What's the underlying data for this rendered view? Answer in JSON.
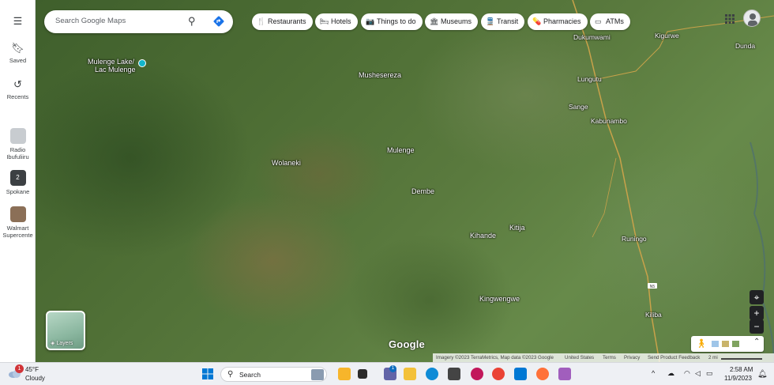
{
  "rail": {
    "menu_icon": "hamburger-menu-icon",
    "items": [
      {
        "label": "Saved",
        "icon": "bookmark-icon"
      },
      {
        "label": "Recents",
        "icon": "history-icon"
      }
    ],
    "recent_places": [
      {
        "label": "Radio Ibufuliiru",
        "color": "#9aa0a6"
      },
      {
        "label": "Spokane",
        "badge": "2",
        "color": "#3c4043"
      },
      {
        "label": "Walmart Supercente",
        "color": "#8b6f57"
      }
    ]
  },
  "search": {
    "placeholder": "Search Google Maps",
    "search_icon": "magnifier-icon",
    "directions_icon": "directions-icon",
    "directions_color": "#1a73e8"
  },
  "chips": [
    {
      "label": "Restaurants",
      "icon": "fork-knife-icon",
      "glyph": "🍴"
    },
    {
      "label": "Hotels",
      "icon": "bed-icon",
      "glyph": "🛏"
    },
    {
      "label": "Things to do",
      "icon": "camera-icon",
      "glyph": "📷"
    },
    {
      "label": "Museums",
      "icon": "museum-icon",
      "glyph": "🏛"
    },
    {
      "label": "Transit",
      "icon": "train-icon",
      "glyph": "🚆"
    },
    {
      "label": "Pharmacies",
      "icon": "pill-icon",
      "glyph": "💊"
    },
    {
      "label": "ATMs",
      "icon": "atm-icon",
      "glyph": "▭"
    }
  ],
  "map": {
    "places": [
      {
        "name": "Mulenge Lake/",
        "type": "poi"
      },
      {
        "name": "Lac Mulenge",
        "type": "poi"
      },
      {
        "name": "Mushesereza"
      },
      {
        "name": "Wolaneki"
      },
      {
        "name": "Mulenge"
      },
      {
        "name": "Dembe"
      },
      {
        "name": "Kitija"
      },
      {
        "name": "Kihande"
      },
      {
        "name": "Kingwengwe"
      },
      {
        "name": "Dukumwami"
      },
      {
        "name": "Kigurwe"
      },
      {
        "name": "Dunda"
      },
      {
        "name": "Lungutu"
      },
      {
        "name": "Sange"
      },
      {
        "name": "Kabunambo"
      },
      {
        "name": "Runingo"
      },
      {
        "name": "Kiliba"
      }
    ],
    "road_shield": "N5",
    "poi_color": "#12b5cb",
    "road_color": "#c9a24a"
  },
  "layers": {
    "label": "Layers"
  },
  "controls": {
    "locate": "⌖",
    "zoom_in": "+",
    "zoom_out": "−"
  },
  "logo": "Google",
  "attribution": {
    "imagery": "Imagery ©2023 TerraMetrics, Map data ©2023 Google",
    "states": "United States",
    "terms": "Terms",
    "privacy": "Privacy",
    "feedback": "Send Product Feedback",
    "scale": "2 mi"
  },
  "taskbar": {
    "weather": {
      "temp": "45°F",
      "condition": "Cloudy",
      "badge": "1"
    },
    "search_label": "Search",
    "apps": [
      {
        "name": "meet-app-icon",
        "color": "#f7b52b"
      },
      {
        "name": "taskview-icon",
        "color": "#2b2b2b"
      },
      {
        "name": "teams-icon",
        "color": "#6264a7",
        "badge": "1"
      },
      {
        "name": "file-explorer-icon",
        "color": "#f3c13a"
      },
      {
        "name": "edge-icon",
        "color": "#0f8bd6"
      },
      {
        "name": "headphones-icon",
        "color": "#c2185b"
      },
      {
        "name": "chrome-icon",
        "color": "#ea4335"
      },
      {
        "name": "vscode-icon",
        "color": "#0078d4"
      },
      {
        "name": "firefox-icon",
        "color": "#ff7139"
      },
      {
        "name": "snipping-tool-icon",
        "color": "#a15ebd"
      }
    ],
    "tray": {
      "chevron": "^",
      "time": "2:58 AM",
      "date": "11/9/2023"
    }
  }
}
